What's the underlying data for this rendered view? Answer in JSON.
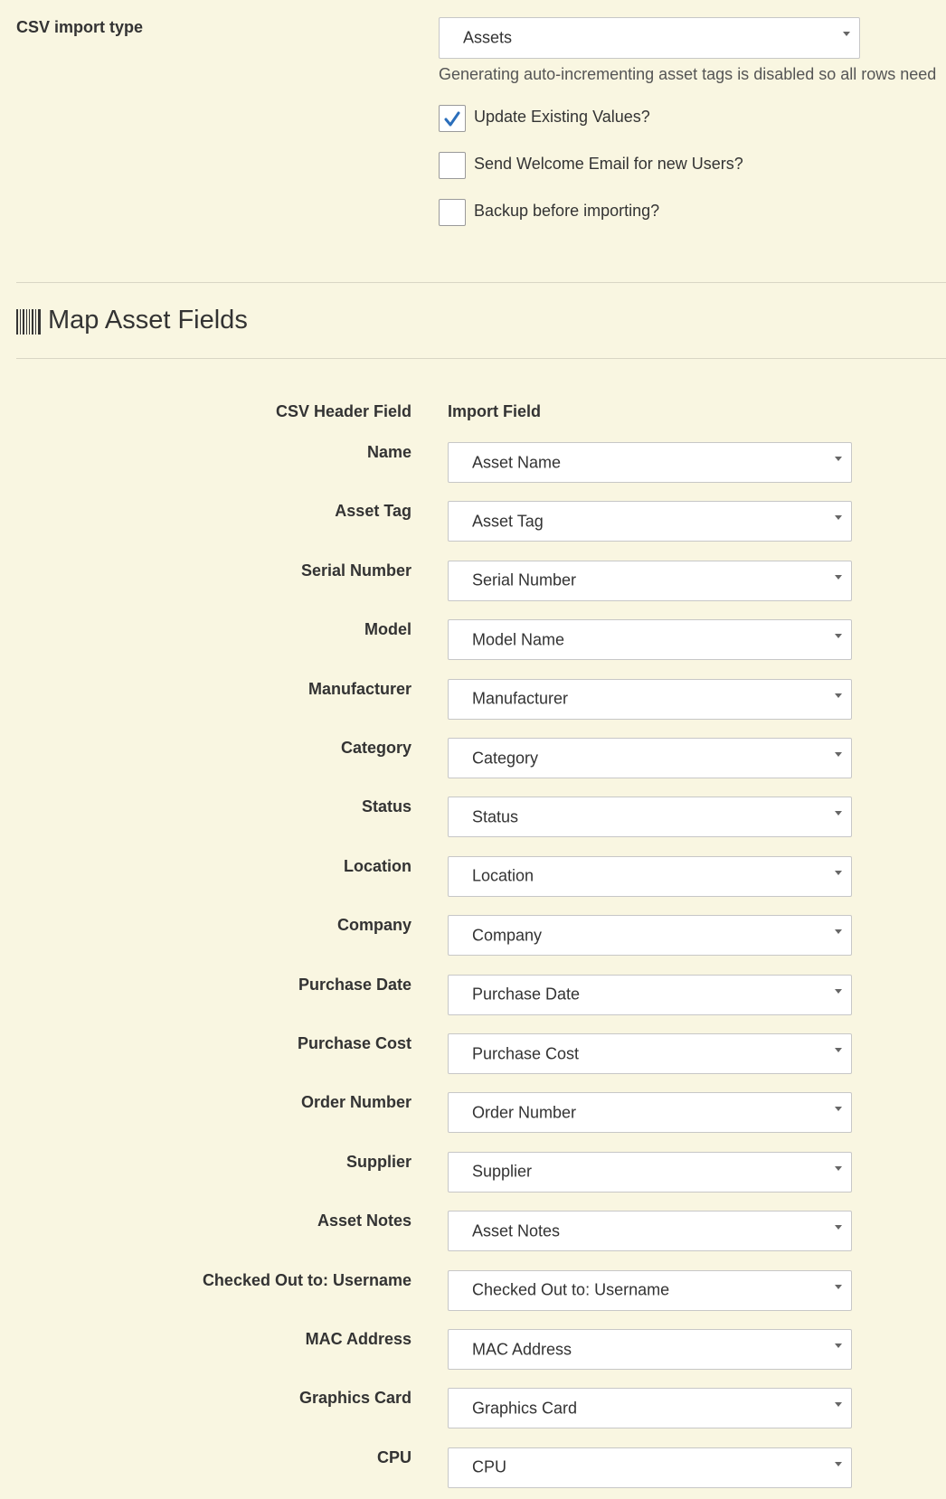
{
  "import_type": {
    "label": "CSV import type",
    "selected": "Assets",
    "help_text": "Generating auto-incrementing asset tags is disabled so all rows need"
  },
  "options": [
    {
      "label": "Update Existing Values?",
      "checked": true
    },
    {
      "label": "Send Welcome Email for new Users?",
      "checked": false
    },
    {
      "label": "Backup before importing?",
      "checked": false
    }
  ],
  "section": {
    "title": "Map Asset Fields",
    "icon": "barcode-icon"
  },
  "table": {
    "header_left": "CSV Header Field",
    "header_right": "Import Field",
    "rows": [
      {
        "csv": "Name",
        "field": "Asset Name"
      },
      {
        "csv": "Asset Tag",
        "field": "Asset Tag"
      },
      {
        "csv": "Serial Number",
        "field": "Serial Number"
      },
      {
        "csv": "Model",
        "field": "Model Name"
      },
      {
        "csv": "Manufacturer",
        "field": "Manufacturer"
      },
      {
        "csv": "Category",
        "field": "Category"
      },
      {
        "csv": "Status",
        "field": "Status"
      },
      {
        "csv": "Location",
        "field": "Location"
      },
      {
        "csv": "Company",
        "field": "Company"
      },
      {
        "csv": "Purchase Date",
        "field": "Purchase Date"
      },
      {
        "csv": "Purchase Cost",
        "field": "Purchase Cost"
      },
      {
        "csv": "Order Number",
        "field": "Order Number"
      },
      {
        "csv": "Supplier",
        "field": "Supplier"
      },
      {
        "csv": "Asset Notes",
        "field": "Asset Notes"
      },
      {
        "csv": "Checked Out to: Username",
        "field": "Checked Out to: Username"
      },
      {
        "csv": "MAC Address",
        "field": "MAC Address"
      },
      {
        "csv": "Graphics Card",
        "field": "Graphics Card"
      },
      {
        "csv": "CPU",
        "field": "CPU"
      }
    ]
  },
  "colors": {
    "background": "#f9f6e1",
    "check_accent": "#2a6ebb"
  }
}
